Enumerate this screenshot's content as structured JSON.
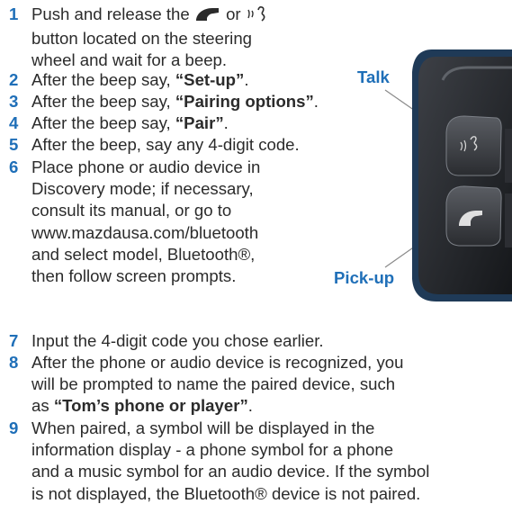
{
  "steps": [
    {
      "num": "1",
      "segments": [
        {
          "type": "text",
          "text": "Push and release the "
        },
        {
          "type": "icon",
          "icon": "phone-pickup-icon"
        },
        {
          "type": "text",
          "text": " or "
        },
        {
          "type": "icon",
          "icon": "talk-icon"
        }
      ],
      "lines": [
        "button located on the steering",
        "wheel and wait for a beep."
      ]
    },
    {
      "num": "2",
      "text": "After the beep say, ",
      "bold": "“Set-up”",
      "after": "."
    },
    {
      "num": "3",
      "text": "After the beep say, ",
      "bold": "“Pairing options”",
      "after": "."
    },
    {
      "num": "4",
      "text": "After the beep say, ",
      "bold": "“Pair”",
      "after": "."
    },
    {
      "num": "5",
      "text": "After the beep, say any 4-digit code."
    },
    {
      "num": "6",
      "lines": [
        "Place phone or audio device in",
        "Discovery mode; if necessary,",
        "consult its manual, or go to",
        "www.mazdausa.com/bluetooth",
        "and select model, Bluetooth®,",
        "then follow screen prompts."
      ]
    },
    {
      "num": "7",
      "text": "Input the 4-digit code you chose earlier."
    },
    {
      "num": "8",
      "lines": [
        "After the phone or audio device is recognized, you",
        "will be prompted to name the paired device, such"
      ],
      "last_prefix": "as ",
      "bold": "“Tom’s phone or player”",
      "after": "."
    },
    {
      "num": "9",
      "lines": [
        "When paired, a symbol will be displayed in the",
        "information display - a phone symbol for a phone",
        "and a music symbol for an audio device. If the symbol",
        "is not displayed, the Bluetooth® device is not paired."
      ]
    }
  ],
  "callouts": {
    "talk": "Talk",
    "pickup": "Pick-up"
  },
  "colors": {
    "accent": "#1f6fb8",
    "text": "#2b2b2b"
  }
}
